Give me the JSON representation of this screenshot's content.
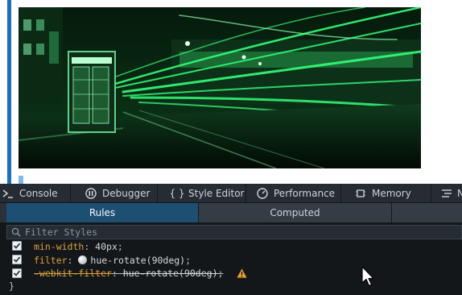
{
  "toolbox": {
    "tabs": [
      {
        "label": "Console",
        "icon": "console-icon"
      },
      {
        "label": "Debugger",
        "icon": "debugger-icon"
      },
      {
        "label": "Style Editor",
        "icon": "braces-icon"
      },
      {
        "label": "Performance",
        "icon": "gauge-icon"
      },
      {
        "label": "Memory",
        "icon": "memory-chip-icon"
      },
      {
        "label": "N",
        "icon": "network-icon"
      }
    ]
  },
  "sidebar_tabs": {
    "rules": "Rules",
    "computed": "Computed"
  },
  "filter": {
    "placeholder": "Filter Styles"
  },
  "rules": [
    {
      "property": "min-width",
      "value": "40px",
      "checked": true,
      "disabled": false
    },
    {
      "property": "filter",
      "value": "hue-rotate(90deg)",
      "checked": true,
      "disabled": false
    },
    {
      "property": "-webkit-filter",
      "value": "hue-rotate(90deg)",
      "checked": true,
      "disabled": true,
      "warning": true
    }
  ],
  "closing_brace": "}",
  "colors": {
    "toolbar_bg": "#252c33",
    "active_subtab": "#1d4f73",
    "panel_bg": "#14171a",
    "property": "#d9a23a",
    "warning": "#f0a030"
  }
}
